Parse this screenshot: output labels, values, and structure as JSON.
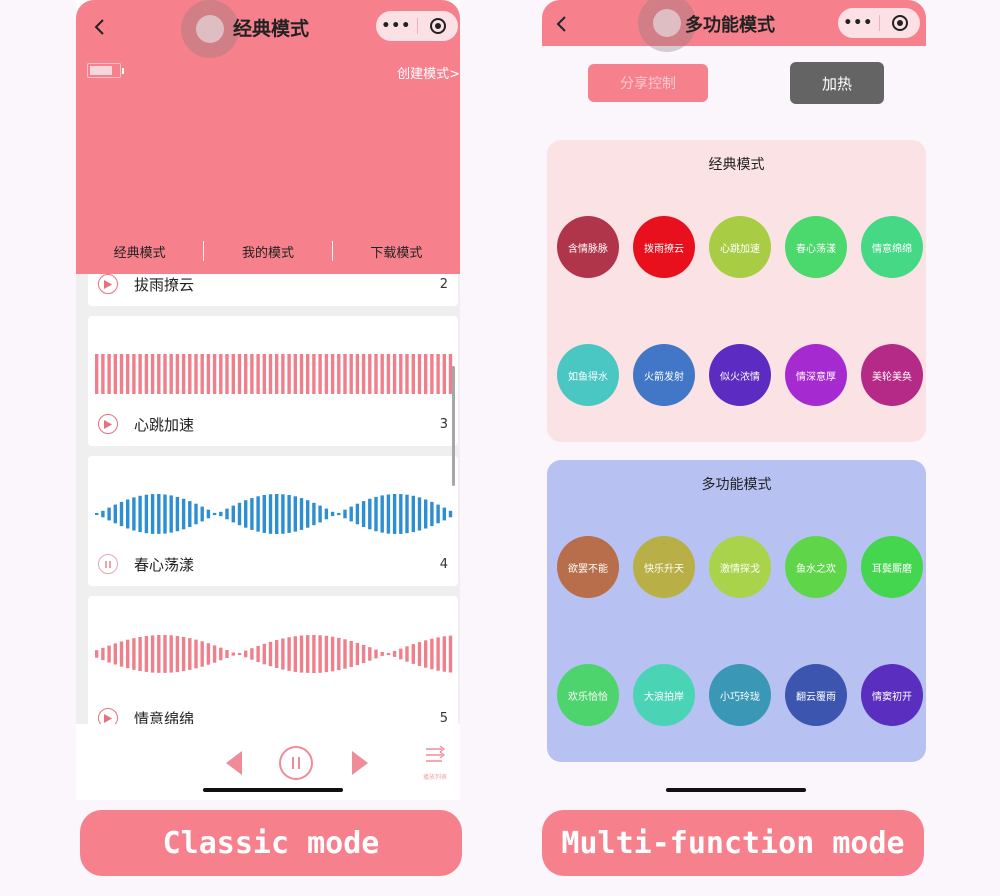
{
  "left_phone": {
    "title": "经典模式",
    "create_mode": "创建模式>",
    "tabs": [
      "经典模式",
      "我的模式",
      "下载模式"
    ],
    "cards": [
      {
        "name": "拔雨撩云",
        "num": "2",
        "wave_color": "#f07f8c"
      },
      {
        "name": "心跳加速",
        "num": "3",
        "wave_color": "#f07f8c"
      },
      {
        "name": "春心荡漾",
        "num": "4",
        "wave_color": "#2d8ed2"
      },
      {
        "name": "情意绵绵",
        "num": "5",
        "wave_color": "#f07f8c"
      }
    ],
    "list_button_label": "播放列表"
  },
  "right_phone": {
    "title": "多功能模式",
    "share_button": "分享控制",
    "heat_button": "加热",
    "classic_panel": {
      "title": "经典模式",
      "background": "#fbe2e4",
      "items": [
        {
          "label": "含情脉脉",
          "color": "#b0344a"
        },
        {
          "label": "拨雨撩云",
          "color": "#e8101c"
        },
        {
          "label": "心跳加速",
          "color": "#a8cc43"
        },
        {
          "label": "春心荡漾",
          "color": "#4bd86d"
        },
        {
          "label": "情意绵绵",
          "color": "#45d985"
        },
        {
          "label": "如鱼得水",
          "color": "#4bc7c3"
        },
        {
          "label": "火箭发射",
          "color": "#4177c6"
        },
        {
          "label": "似火浓情",
          "color": "#5b2bc2"
        },
        {
          "label": "情深意厚",
          "color": "#a52bd0"
        },
        {
          "label": "美轮美奂",
          "color": "#b52a86"
        }
      ]
    },
    "multi_panel": {
      "title": "多功能模式",
      "background": "#b7c1f2",
      "items": [
        {
          "label": "欲罢不能",
          "color": "#b86e4a"
        },
        {
          "label": "快乐升天",
          "color": "#b8b046"
        },
        {
          "label": "激情探戈",
          "color": "#a9d34b"
        },
        {
          "label": "鱼水之欢",
          "color": "#5fd64a"
        },
        {
          "label": "耳鬓厮磨",
          "color": "#44d64e"
        },
        {
          "label": "欢乐恰恰",
          "color": "#4ed46c"
        },
        {
          "label": "大浪拍岸",
          "color": "#4bd3b6"
        },
        {
          "label": "小巧玲珑",
          "color": "#3a97b6"
        },
        {
          "label": "翻云覆雨",
          "color": "#3c56b0"
        },
        {
          "label": "情窦初开",
          "color": "#5a2fbf"
        }
      ]
    }
  },
  "captions": {
    "left": "Classic mode",
    "right": "Multi-function mode"
  },
  "colors": {
    "accent_pink": "#f6818d",
    "dark_button": "#646464"
  }
}
